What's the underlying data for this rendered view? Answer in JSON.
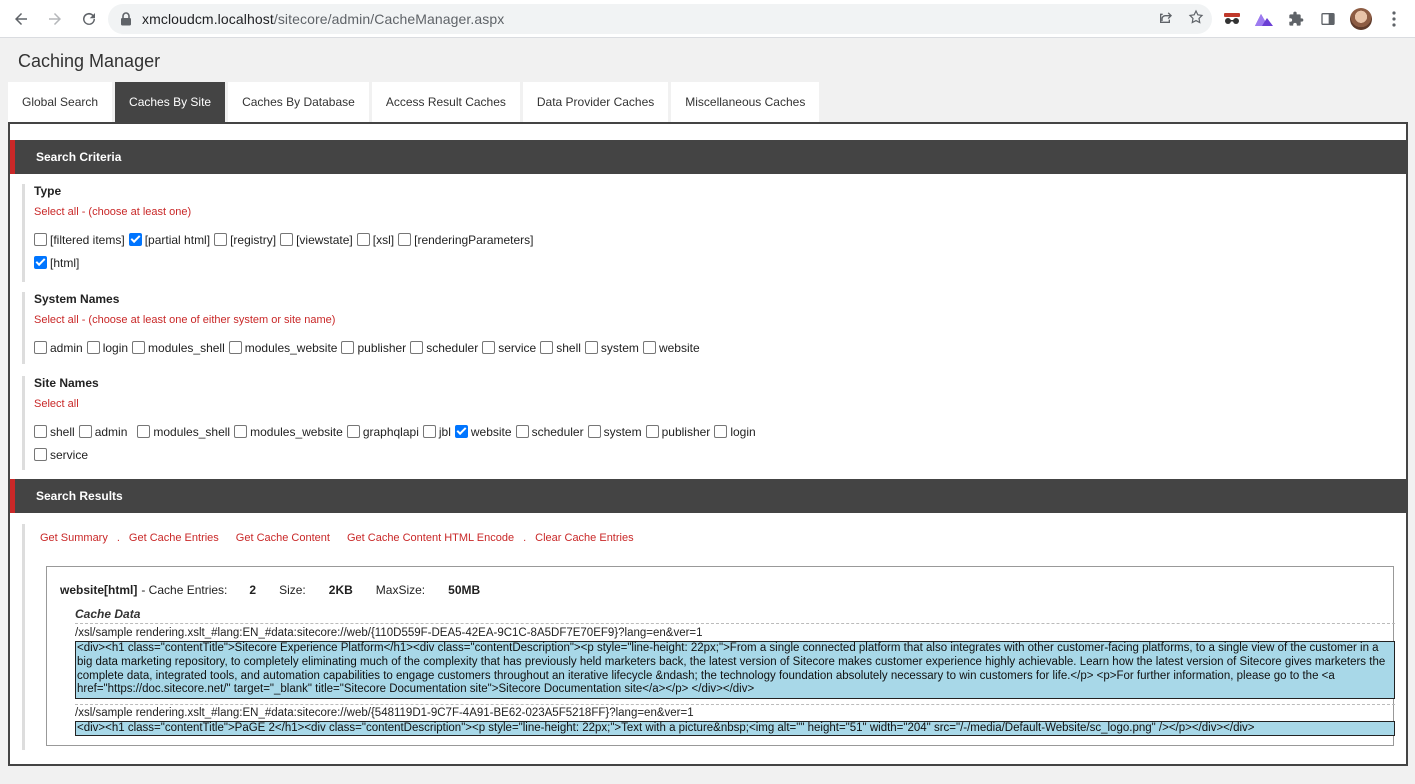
{
  "browser": {
    "url_host": "xmcloudcm.localhost",
    "url_path": "/sitecore/admin/CacheManager.aspx"
  },
  "page": {
    "title": "Caching Manager"
  },
  "tabs": [
    {
      "label": "Global Search",
      "active": false
    },
    {
      "label": "Caches By Site",
      "active": true
    },
    {
      "label": "Caches By Database",
      "active": false
    },
    {
      "label": "Access Result Caches",
      "active": false
    },
    {
      "label": "Data Provider Caches",
      "active": false
    },
    {
      "label": "Miscellaneous Caches",
      "active": false
    }
  ],
  "search_criteria": {
    "heading": "Search Criteria",
    "type": {
      "title": "Type",
      "select_all": "Select all - (choose at least one)",
      "options": [
        {
          "label": "[filtered items]",
          "checked": false
        },
        {
          "label": "[partial html]",
          "checked": true
        },
        {
          "label": "[registry]",
          "checked": false
        },
        {
          "label": "[viewstate]",
          "checked": false
        },
        {
          "label": "[xsl]",
          "checked": false
        },
        {
          "label": "[renderingParameters]",
          "checked": false
        },
        {
          "label": "[html]",
          "checked": true
        }
      ]
    },
    "system_names": {
      "title": "System Names",
      "select_all": "Select all - (choose at least one of either system or site name)",
      "options": [
        {
          "label": "admin",
          "checked": false
        },
        {
          "label": "login",
          "checked": false
        },
        {
          "label": "modules_shell",
          "checked": false
        },
        {
          "label": "modules_website",
          "checked": false
        },
        {
          "label": "publisher",
          "checked": false
        },
        {
          "label": "scheduler",
          "checked": false
        },
        {
          "label": "service",
          "checked": false
        },
        {
          "label": "shell",
          "checked": false
        },
        {
          "label": "system",
          "checked": false
        },
        {
          "label": "website",
          "checked": false
        }
      ]
    },
    "site_names": {
      "title": "Site Names",
      "select_all": "Select all",
      "options": [
        {
          "label": "shell",
          "checked": false
        },
        {
          "label": "admin",
          "checked": false
        },
        {
          "label": "modules_shell",
          "checked": false
        },
        {
          "label": "modules_website",
          "checked": false
        },
        {
          "label": "graphqlapi",
          "checked": false
        },
        {
          "label": "jbl",
          "checked": false
        },
        {
          "label": "website",
          "checked": true
        },
        {
          "label": "scheduler",
          "checked": false
        },
        {
          "label": "system",
          "checked": false
        },
        {
          "label": "publisher",
          "checked": false
        },
        {
          "label": "login",
          "checked": false
        },
        {
          "label": "service",
          "checked": false
        }
      ]
    }
  },
  "search_results": {
    "heading": "Search Results",
    "actions": {
      "get_summary": "Get Summary",
      "get_cache_entries": "Get Cache Entries",
      "get_cache_content": "Get Cache Content",
      "get_cache_content_html_encode": "Get Cache Content HTML Encode",
      "clear_cache_entries": "Clear Cache Entries",
      "separator": "."
    },
    "result": {
      "name": "website[html]",
      "entries_label": "- Cache Entries:",
      "entries_value": "2",
      "size_label": "Size:",
      "size_value": "2KB",
      "maxsize_label": "MaxSize:",
      "maxsize_value": "50MB",
      "cache_data_label": "Cache Data",
      "entries": [
        {
          "key": "/xsl/sample rendering.xslt_#lang:EN_#data:sitecore://web/{110D559F-DEA5-42EA-9C1C-8A5DF7E70EF9}?lang=en&ver=1",
          "value": "<div><h1 class=\"contentTitle\">Sitecore Experience Platform</h1><div class=\"contentDescription\"><p style=\"line-height: 22px;\">From a single connected platform that also integrates with other customer-facing platforms, to a single view of the customer in a big data marketing repository, to completely eliminating much of the complexity that has previously held marketers back, the latest version of Sitecore makes customer experience highly achievable. Learn how the latest version of Sitecore gives marketers the complete data, integrated tools, and automation capabilities to engage customers throughout an iterative lifecycle &ndash; the technology foundation absolutely necessary to win customers for life.</p> <p>For further information, please go to the <a href=\"https://doc.sitecore.net/\" target=\"_blank\" title=\"Sitecore Documentation site\">Sitecore Documentation site</a></p> </div></div>"
        },
        {
          "key": "/xsl/sample rendering.xslt_#lang:EN_#data:sitecore://web/{548119D1-9C7F-4A91-BE62-023A5F5218FF}?lang=en&ver=1",
          "value": "<div><h1 class=\"contentTitle\">PaGE 2</h1><div class=\"contentDescription\"><p style=\"line-height: 22px;\">Text with a picture&nbsp;<img alt=\"\" height=\"51\" width=\"204\" src=\"/-/media/Default-Website/sc_logo.png\" /></p></div></div>"
        }
      ]
    }
  }
}
